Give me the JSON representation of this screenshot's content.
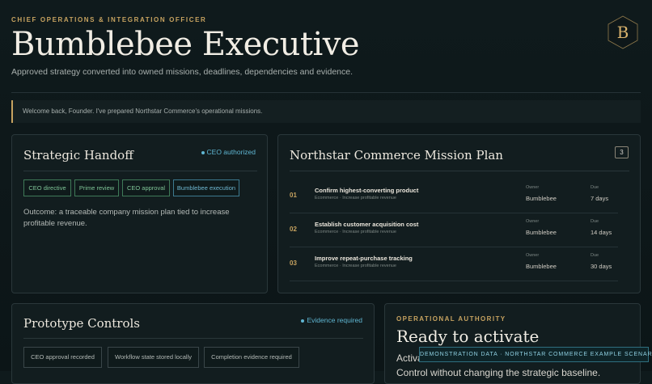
{
  "header": {
    "eyebrow": "CHIEF OPERATIONS & INTEGRATION OFFICER",
    "title": "Bumblebee Executive",
    "subtitle": "Approved strategy converted into owned missions, deadlines, dependencies and evidence.",
    "logo_letter": "B"
  },
  "welcome": "Welcome back, Founder. I've prepared Northstar Commerce's operational missions.",
  "handoff": {
    "title": "Strategic Handoff",
    "status": "CEO authorized",
    "chips": [
      "CEO directive",
      "Prime review",
      "CEO approval",
      "Bumblebee execution"
    ],
    "outcome": "Outcome: a traceable company mission plan tied to increase profitable revenue."
  },
  "mission_plan": {
    "title": "Northstar Commerce Mission Plan",
    "count": "3",
    "owner_label": "Owner",
    "due_label": "Due",
    "missions": [
      {
        "num": "01",
        "title": "Confirm highest-converting product",
        "sub": "Ecommerce · Increase profitable revenue",
        "owner": "Bumblebee",
        "due": "7 days"
      },
      {
        "num": "02",
        "title": "Establish customer acquisition cost",
        "sub": "Ecommerce · Increase profitable revenue",
        "owner": "Bumblebee",
        "due": "14 days"
      },
      {
        "num": "03",
        "title": "Improve repeat-purchase tracking",
        "sub": "Ecommerce · Increase profitable revenue",
        "owner": "Bumblebee",
        "due": "30 days"
      }
    ]
  },
  "prototype": {
    "title": "Prototype Controls",
    "status": "Evidence required",
    "controls": [
      "CEO approval recorded",
      "Workflow state stored locally",
      "Completion evidence required"
    ]
  },
  "authority": {
    "eyebrow": "OPERATIONAL AUTHORITY",
    "title": "Ready to activate",
    "body_line1": "Activa",
    "body_line2": "Control without changing the strategic baseline."
  },
  "banner": "DEMONSTRATION DATA · NORTHSTAR COMMERCE EXAMPLE SCENARIO",
  "colors": {
    "accent_gold": "#c7a360",
    "accent_blue": "#5fb6d2",
    "accent_green": "#7fc597",
    "background": "#0f1a1c"
  }
}
